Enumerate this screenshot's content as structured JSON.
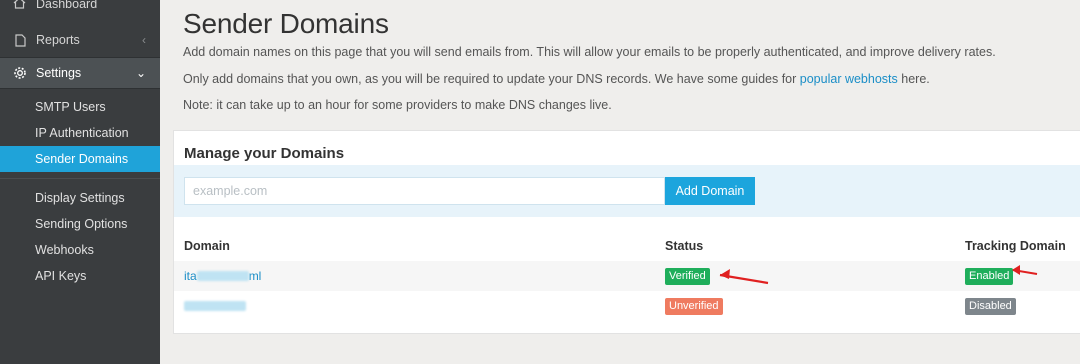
{
  "sidebar": {
    "dashboard": "Dashboard",
    "reports": "Reports",
    "settings": "Settings",
    "settings_sub": [
      "SMTP Users",
      "IP Authentication",
      "Sender Domains"
    ],
    "other_sub": [
      "Display Settings",
      "Sending Options",
      "Webhooks",
      "API Keys"
    ]
  },
  "page": {
    "title": "Sender Domains",
    "p1": "Add domain names on this page that you will send emails from. This will allow your emails to be properly authenticated, and improve delivery rates.",
    "p2_before": "Only add domains that you own, as you will be required to update your DNS records. We have some guides for",
    "p2_link": "popular webhosts",
    "p2_after": "here.",
    "p3": "Note: it can take up to an hour for some providers to make DNS changes live."
  },
  "panel": {
    "title": "Manage your Domains",
    "input_placeholder": "example.com",
    "add_button": "Add Domain",
    "headers": {
      "domain": "Domain",
      "status": "Status",
      "tracking": "Tracking Domain"
    },
    "rows": [
      {
        "domain_prefix": "ita",
        "domain_suffix": "ml",
        "status": "Verified",
        "tracking": "Enabled"
      },
      {
        "domain_prefix": "",
        "domain_suffix": "",
        "status": "Unverified",
        "tracking": "Disabled"
      }
    ]
  },
  "colors": {
    "accent": "#1ca5dd",
    "verified": "#1fae5b",
    "unverified": "#ef7b60",
    "disabled": "#7e868c",
    "arrow": "#e02020"
  }
}
